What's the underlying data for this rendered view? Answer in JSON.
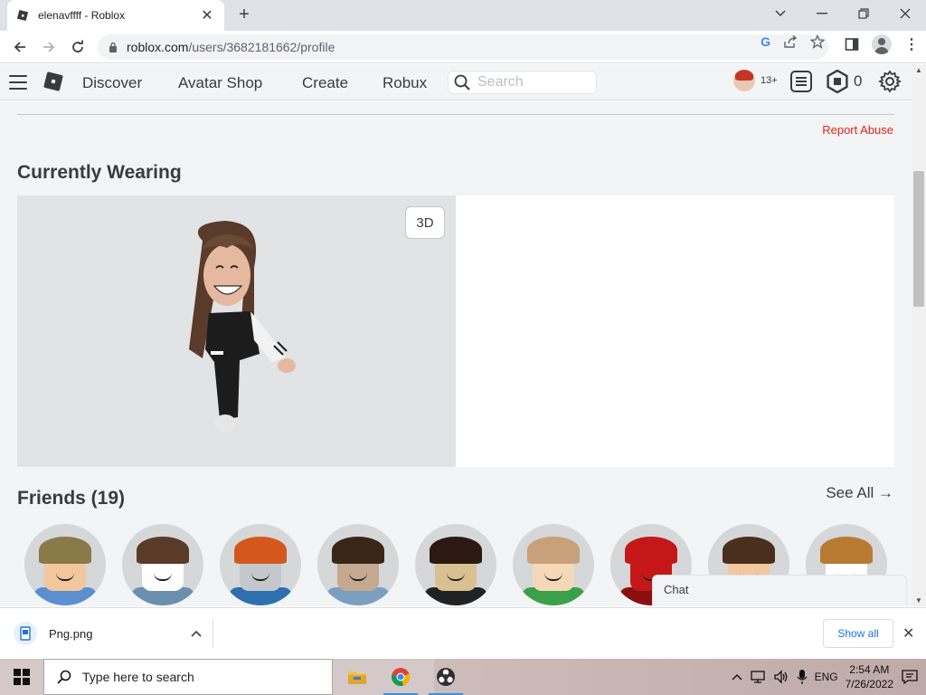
{
  "browser": {
    "tab_title": "elenavffff - Roblox",
    "url_domain": "roblox.com",
    "url_path": "/users/3682181662/profile"
  },
  "header": {
    "nav": [
      "Discover",
      "Avatar Shop",
      "Create",
      "Robux"
    ],
    "search_placeholder": "Search",
    "age_badge": "13+",
    "robux_count": "0"
  },
  "profile": {
    "report_abuse": "Report Abuse",
    "currently_wearing": "Currently Wearing",
    "btn_3d": "3D",
    "friends_title": "Friends (19)",
    "see_all": "See All →"
  },
  "chat": {
    "label": "Chat"
  },
  "downloads": {
    "file_name": "Png.png",
    "show_all": "Show all"
  },
  "taskbar": {
    "search_placeholder": "Type here to search",
    "lang": "ENG",
    "time": "2:54 AM",
    "date": "7/26/2022"
  },
  "friends": [
    {
      "hair": "#8a7a4a",
      "skin": "#f2c79d",
      "body": "#5b8fd0"
    },
    {
      "hair": "#5a3a28",
      "skin": "#ffffff",
      "body": "#6a8fb0"
    },
    {
      "hair": "#d4581e",
      "skin": "#c4c8cc",
      "body": "#2e6fb0"
    },
    {
      "hair": "#3a2618",
      "skin": "#c4a890",
      "body": "#7a9fc0"
    },
    {
      "hair": "#2c1a12",
      "skin": "#d8c090",
      "body": "#222222"
    },
    {
      "hair": "#c8a07a",
      "skin": "#f5d8b8",
      "body": "#3aa04a"
    },
    {
      "hair": "#c41818",
      "skin": "#c41818",
      "body": "#8a1010"
    },
    {
      "hair": "#4a2e1e",
      "skin": "#f2c79d",
      "body": "#333333"
    },
    {
      "hair": "#b87a30",
      "skin": "#ffffff",
      "body": "#d8d8d8"
    }
  ]
}
